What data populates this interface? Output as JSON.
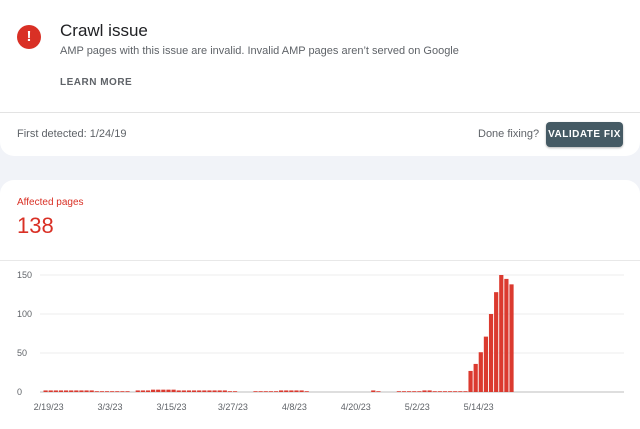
{
  "issue": {
    "title": "Crawl issue",
    "icon": "error-icon",
    "icon_glyph": "!",
    "description": "AMP pages with this issue are invalid. Invalid AMP pages aren’t served on Google",
    "learn_more_label": "LEARN MORE",
    "first_detected": "First detected: 1/24/19",
    "done_fixing_label": "Done fixing?",
    "validate_label": "VALIDATE FIX"
  },
  "summary": {
    "label": "Affected pages",
    "value": "138"
  },
  "colors": {
    "accent_red": "#d93025",
    "button_bg": "#455a64",
    "bar_color": "#db3a2f"
  },
  "chart_data": {
    "type": "bar",
    "title": "",
    "xlabel": "",
    "ylabel": "",
    "ylim": [
      0,
      150
    ],
    "yticks": [
      0,
      50,
      100,
      150
    ],
    "grid": true,
    "x_tick_labels": [
      "2/19/23",
      "3/3/23",
      "3/15/23",
      "3/27/23",
      "4/8/23",
      "4/20/23",
      "5/2/23",
      "5/14/23"
    ],
    "x_tick_day_index": [
      0,
      12,
      24,
      36,
      48,
      60,
      72,
      84
    ],
    "values": [
      2,
      2,
      2,
      2,
      2,
      2,
      2,
      2,
      2,
      2,
      1,
      1,
      1,
      1,
      1,
      1,
      1,
      0,
      2,
      2,
      2,
      3,
      3,
      3,
      3,
      3,
      2,
      2,
      2,
      2,
      2,
      2,
      2,
      2,
      2,
      2,
      1,
      1,
      0,
      0,
      0,
      1,
      1,
      1,
      1,
      1,
      2,
      2,
      2,
      2,
      2,
      1,
      0,
      0,
      0,
      0,
      0,
      0,
      0,
      0,
      0,
      0,
      0,
      0,
      2,
      1,
      0,
      0,
      0,
      1,
      1,
      1,
      1,
      1,
      2,
      2,
      1,
      1,
      1,
      1,
      1,
      1,
      1,
      27,
      36,
      51,
      71,
      100,
      128,
      150,
      145,
      138
    ]
  }
}
